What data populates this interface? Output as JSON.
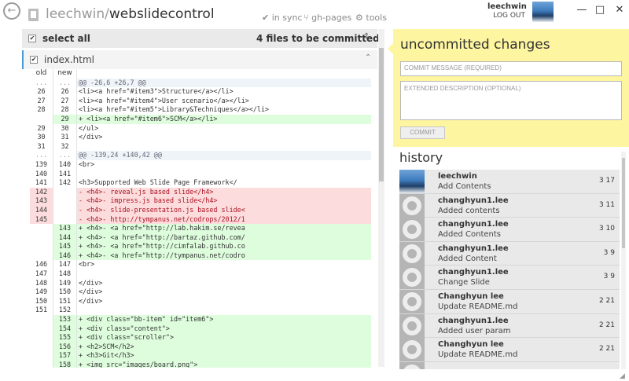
{
  "header": {
    "owner": "leechwin",
    "separator": "/",
    "repo": "webslidecontrol",
    "sync_label": "in sync",
    "branch_label": "gh-pages",
    "tools_label": "tools",
    "user_name": "leechwin",
    "logout_label": "LOG OUT",
    "back_icon": "arrow-left-circle-icon",
    "colors": {
      "accent": "#4a9ad8",
      "muted": "#9a9a9a"
    }
  },
  "window": {
    "minimize": "—",
    "maximize": "□",
    "close": "✕"
  },
  "changes": {
    "select_all_label": "select all",
    "files_count": "4 files to be committed",
    "file_name": "index.html"
  },
  "diff": {
    "col_old": "old",
    "col_new": "new",
    "rows": [
      {
        "t": "hdr",
        "o": "old",
        "n": "new",
        "c": ""
      },
      {
        "t": "hunk",
        "o": "...",
        "n": "...",
        "c": "@@ -26,6 +26,7 @@"
      },
      {
        "t": "ctx",
        "o": "26",
        "n": "26",
        "c": "                <li><a href=\"#item3\">Structure</a></li>"
      },
      {
        "t": "ctx",
        "o": "27",
        "n": "27",
        "c": "                <li><a href=\"#item4\">User scenario</a></li>"
      },
      {
        "t": "ctx",
        "o": "28",
        "n": "28",
        "c": "                <li><a href=\"#item5\">Library&Techniques</a></li>"
      },
      {
        "t": "add",
        "o": "",
        "n": "29",
        "c": "+               <li><a href=\"#item6\">SCM</a></li>"
      },
      {
        "t": "ctx",
        "o": "29",
        "n": "30",
        "c": "            </ul>"
      },
      {
        "t": "ctx",
        "o": "30",
        "n": "31",
        "c": "        </div>"
      },
      {
        "t": "ctx",
        "o": "31",
        "n": "32",
        "c": ""
      },
      {
        "t": "hunk",
        "o": "...",
        "n": "...",
        "c": "@@ -139,24 +140,42 @@"
      },
      {
        "t": "ctx",
        "o": "139",
        "n": "140",
        "c": "                            <br>"
      },
      {
        "t": "ctx",
        "o": "140",
        "n": "141",
        "c": ""
      },
      {
        "t": "ctx",
        "o": "141",
        "n": "142",
        "c": "                            <h3>Supported Web Slide Page Framework</"
      },
      {
        "t": "del",
        "o": "142",
        "n": "",
        "c": "-                           <h4>- reveal.js based slide</h4>"
      },
      {
        "t": "del",
        "o": "143",
        "n": "",
        "c": "-                           <h4>- impress.js based slide</h4>"
      },
      {
        "t": "del",
        "o": "144",
        "n": "",
        "c": "-                           <h4>- slide-presentation.js based slide<"
      },
      {
        "t": "del",
        "o": "145",
        "n": "",
        "c": "-                           <h4>- http://tympanus.net/codrops/2012/1"
      },
      {
        "t": "add",
        "o": "",
        "n": "143",
        "c": "+                           <h4>- <a href=\"http://lab.hakim.se/revea"
      },
      {
        "t": "add",
        "o": "",
        "n": "144",
        "c": "+                           <h4>- <a href=\"http://bartaz.github.com/"
      },
      {
        "t": "add",
        "o": "",
        "n": "145",
        "c": "+                           <h4>- <a href=\"http://cimfalab.github.co"
      },
      {
        "t": "add",
        "o": "",
        "n": "146",
        "c": "+                           <h4>- <a href=\"http://tympanus.net/codro"
      },
      {
        "t": "ctx",
        "o": "146",
        "n": "147",
        "c": "                            <br>"
      },
      {
        "t": "ctx",
        "o": "147",
        "n": "148",
        "c": ""
      },
      {
        "t": "ctx",
        "o": "148",
        "n": "149",
        "c": "                    </div>"
      },
      {
        "t": "ctx",
        "o": "149",
        "n": "150",
        "c": "                </div>"
      },
      {
        "t": "ctx",
        "o": "150",
        "n": "151",
        "c": "            </div>"
      },
      {
        "t": "ctx",
        "o": "151",
        "n": "152",
        "c": ""
      },
      {
        "t": "add",
        "o": "",
        "n": "153",
        "c": "+               <div class=\"bb-item\" id=\"item6\">"
      },
      {
        "t": "add",
        "o": "",
        "n": "154",
        "c": "+                   <div class=\"content\">"
      },
      {
        "t": "add",
        "o": "",
        "n": "155",
        "c": "+                       <div class=\"scroller\">"
      },
      {
        "t": "add",
        "o": "",
        "n": "156",
        "c": "+                           <h2>SCM</h2>"
      },
      {
        "t": "add",
        "o": "",
        "n": "157",
        "c": "+                           <h3>Git</h3>"
      },
      {
        "t": "add",
        "o": "",
        "n": "158",
        "c": "+                           <img src=\"images/board.png\">"
      }
    ]
  },
  "commit": {
    "title": "uncommitted changes",
    "message_placeholder": "COMMIT MESSAGE (REQUIRED)",
    "description_placeholder": "EXTENDED DESCRIPTION (OPTIONAL)",
    "button_label": "COMMIT",
    "colors": {
      "panel_bg": "#fdf59f"
    }
  },
  "history": {
    "title": "history",
    "items": [
      {
        "author": "leechwin",
        "message": "Add Contents",
        "date": "3 17",
        "avatar": "photo"
      },
      {
        "author": "changhyun1.lee",
        "message": "Added contents",
        "date": "3 11",
        "avatar": "octocat"
      },
      {
        "author": "changhyun1.lee",
        "message": "Added Contents",
        "date": "3 10",
        "avatar": "octocat"
      },
      {
        "author": "changhyun1.lee",
        "message": "Added Content",
        "date": "3 9",
        "avatar": "octocat"
      },
      {
        "author": "changhyun1.lee",
        "message": "Change Slide",
        "date": "3 9",
        "avatar": "octocat"
      },
      {
        "author": "Changhyun lee",
        "message": "Update README.md",
        "date": "2 21",
        "avatar": "octocat"
      },
      {
        "author": "changhyun1.lee",
        "message": "Added user param",
        "date": "2 21",
        "avatar": "octocat"
      },
      {
        "author": "Changhyun lee",
        "message": "Update README.md",
        "date": "2 21",
        "avatar": "octocat"
      },
      {
        "author": "",
        "message": "",
        "date": "",
        "avatar": "octocat"
      }
    ]
  }
}
